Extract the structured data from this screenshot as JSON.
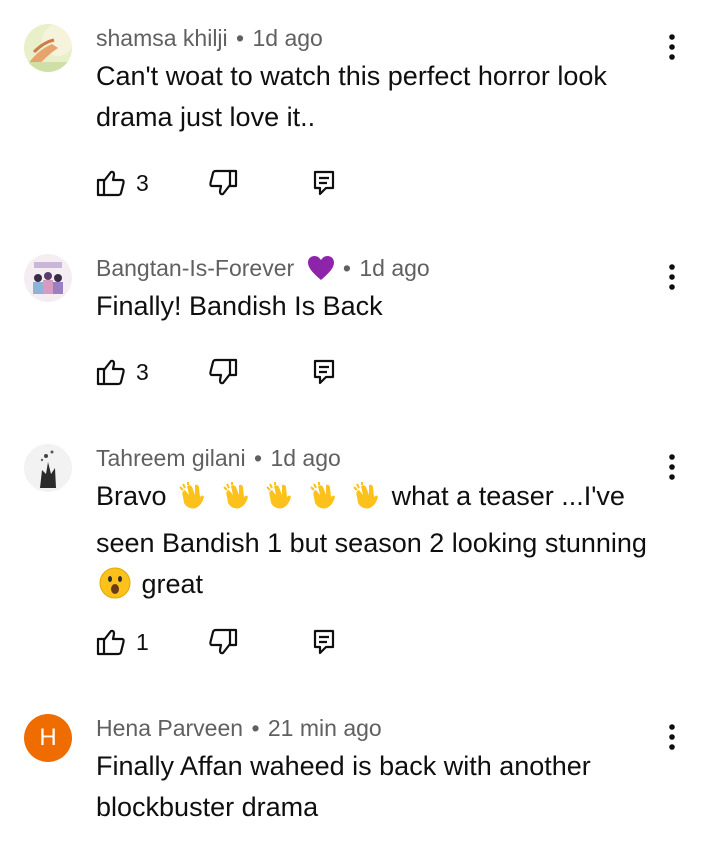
{
  "comments": [
    {
      "author": "shamsa khilji",
      "separator": "•",
      "time": "1d ago",
      "text": "Can't woat to watch this perfect horror  look drama just love it..",
      "likes": "3",
      "avatar": "photo"
    },
    {
      "author": "Bangtan-Is-Forever",
      "separator": "•",
      "time": "1d ago",
      "text": "Finally! Bandish Is Back",
      "likes": "3",
      "avatar": "photo",
      "name_emoji": "purple-heart-icon"
    },
    {
      "author": "Tahreem gilani",
      "separator": "•",
      "time": "1d ago",
      "text_parts": [
        "Bravo",
        "what a teaser ...I've seen Bandish 1 but season 2 looking stunning",
        "great"
      ],
      "likes": "1",
      "avatar": "photo"
    },
    {
      "author": "Hena Parveen",
      "separator": "•",
      "time": "21 min ago",
      "text": "Finally Affan waheed is back with another blockbuster drama",
      "avatar_letter": "H",
      "avatar_color": "#ef6c00"
    }
  ],
  "icons": {
    "like": "thumbs-up-icon",
    "dislike": "thumbs-down-icon",
    "reply": "reply-icon",
    "menu": "more-vert-icon"
  },
  "colors": {
    "meta_text": "#606060",
    "body_text": "#0f0f0f"
  }
}
